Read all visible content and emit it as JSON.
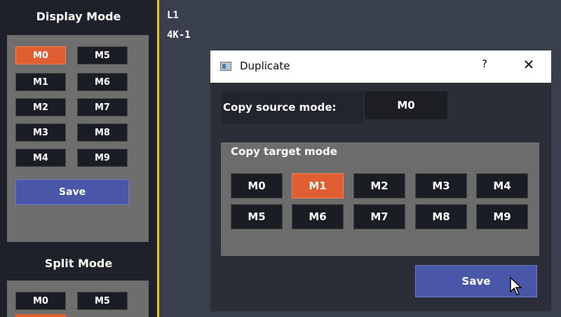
{
  "sidebar": {
    "display_mode": {
      "title": "Display Mode",
      "buttons": [
        "M0",
        "M1",
        "M2",
        "M3",
        "M4",
        "M5",
        "M6",
        "M7",
        "M8",
        "M9"
      ],
      "active_index": 0,
      "save_label": "Save"
    },
    "split_mode": {
      "title": "Split Mode",
      "buttons": [
        "M0",
        "M5"
      ]
    }
  },
  "layer": {
    "line1": "L1",
    "line2": "4K-1"
  },
  "dialog": {
    "title": "Duplicate",
    "help_label": "?",
    "close_label": "✕",
    "source_label": "Copy source mode:",
    "source_value": "M0",
    "target_label": "Copy target mode",
    "target_buttons": [
      "M0",
      "M1",
      "M2",
      "M3",
      "M4",
      "M5",
      "M6",
      "M7",
      "M8",
      "M9"
    ],
    "target_active_index": 1,
    "save_label": "Save"
  },
  "colors": {
    "accent_orange": "#e05e32",
    "save_blue": "#4a57a8",
    "divider_yellow": "#e2c43c"
  },
  "icons": {
    "title": "window-app-icon",
    "pointer": "mouse-cursor-icon"
  }
}
